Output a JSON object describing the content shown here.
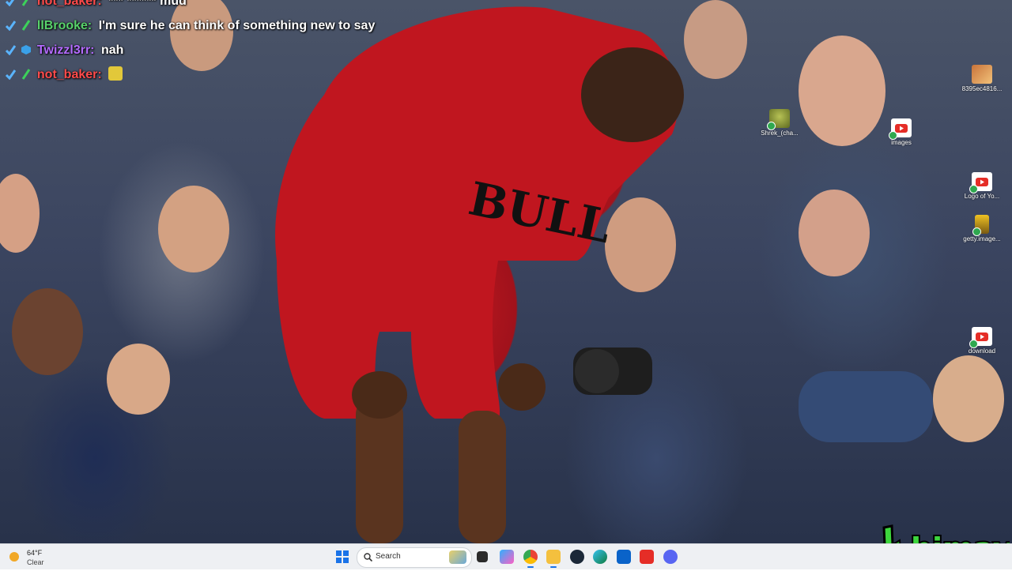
{
  "stream_chat": [
    {
      "user": "not_baker:",
      "user_color": "#ff4b4b",
      "message": "*** ****** mud"
    },
    {
      "user": "llBrooke:",
      "user_color": "#58d26b",
      "message": "I'm sure he can think of something new to say"
    },
    {
      "user": "Twizzl3rr:",
      "user_color": "#b46bff",
      "message": "nah"
    },
    {
      "user": "not_baker:",
      "user_color": "#ff4b4b",
      "message": ""
    }
  ],
  "desktop_icons": [
    {
      "label": "8395ec4816...",
      "icon": "image-file-icon"
    },
    {
      "label": "Shrek_(cha...",
      "icon": "shrek-icon"
    },
    {
      "label": "images",
      "icon": "youtube-icon"
    },
    {
      "label": "Logo of Yo...",
      "icon": "youtube-icon"
    },
    {
      "label": "getty.image...",
      "icon": "image-file-icon"
    },
    {
      "label": "download",
      "icon": "youtube-icon"
    }
  ],
  "taskbar": {
    "weather_temp": "64°F",
    "weather_condition": "Clear",
    "search_placeholder": "Search",
    "apps": [
      "start-icon",
      "task-view-icon",
      "copilot-icon",
      "chrome-icon",
      "file-explorer-icon",
      "steam-icon",
      "edge-icon",
      "store-icon",
      "youtube-icon",
      "discord-icon"
    ]
  },
  "streamer_logo": "himay",
  "colors": {
    "accent_green": "#3dd63d",
    "jersey_red": "#c0161f",
    "taskbar_bg": "#eef0f3"
  }
}
